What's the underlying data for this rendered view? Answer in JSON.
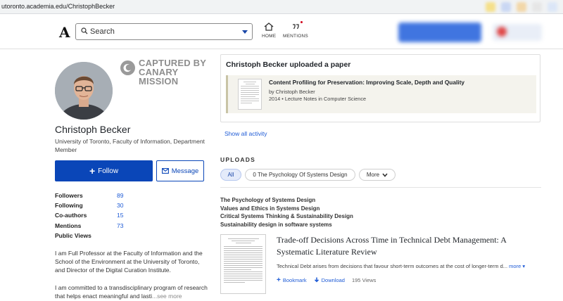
{
  "browser": {
    "url": "utoronto.academia.edu/ChristophBecker"
  },
  "header": {
    "logo": "A",
    "search_placeholder": "Search",
    "nav": [
      {
        "label": "HOME",
        "icon": "home-icon"
      },
      {
        "label": "MENTIONS",
        "icon": "mentions-icon"
      }
    ]
  },
  "watermark": {
    "line1": "CAPTURED BY",
    "line2": "CANARY MISSION"
  },
  "profile": {
    "name": "Christoph Becker",
    "affiliation": "University of Toronto, Faculty of Information, Department Member",
    "follow_label": "Follow",
    "message_label": "Message",
    "stats": [
      {
        "label": "Followers",
        "value": "89"
      },
      {
        "label": "Following",
        "value": "30"
      },
      {
        "label": "Co-authors",
        "value": "15"
      },
      {
        "label": "Mentions",
        "value": "73"
      },
      {
        "label": "Public Views",
        "value": ""
      }
    ],
    "bio_p1": "I am Full Professor at the Faculty of Information and the School of the Environment at the University of Toronto, and Director of the Digital Curation Institute.",
    "bio_p2": "I am committed to a transdisciplinary program of research that helps enact meaningful and lasti",
    "bio_see_more": "...see more"
  },
  "activity": {
    "header": "Christoph Becker uploaded a paper",
    "paper_title": "Content Profiling for Preservation: Improving Scale, Depth and Quality",
    "paper_by": "by Christoph Becker",
    "paper_meta": "2014 • Lecture Notes in Computer Science",
    "show_all": "Show all activity"
  },
  "uploads": {
    "heading": "UPLOADS",
    "filters": [
      "All",
      "0 The Psychology Of Systems Design",
      "More"
    ],
    "topics": [
      "The Psychology of Systems Design",
      "Values and Ethics in Systems Design",
      "Critical Systems Thinking & Sustainability Design",
      "Sustainability design in software systems"
    ],
    "work": {
      "title": "Trade-off Decisions Across Time in Technical Debt Management: A Systematic Literature Review",
      "abstract": "Technical Debt arises from decisions that favour short-term outcomes at the cost of longer-term d...",
      "more": "more",
      "bookmark": "Bookmark",
      "download": "Download",
      "views": "195 Views"
    }
  },
  "colors": {
    "accent": "#0a46b8",
    "link": "#1e5bd6"
  }
}
